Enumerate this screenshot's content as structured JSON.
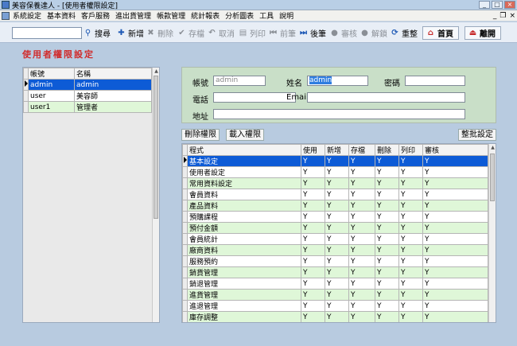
{
  "window": {
    "title": "美容保養達人 - [使用者權限設定]"
  },
  "menu": [
    "系統設定",
    "基本資料",
    "客戶服務",
    "進出貨管理",
    "帳款管理",
    "統計報表",
    "分析圖表",
    "工具",
    "說明"
  ],
  "toolbar": {
    "search_value": "",
    "search": "搜尋",
    "add": "新增",
    "delete": "刪除",
    "save": "存檔",
    "cancel": "取消",
    "print": "列印",
    "prev": "前筆",
    "next": "後筆",
    "audit": "審核",
    "unaudit": "解鎖",
    "refresh": "重整",
    "home": "首頁",
    "exit": "離開"
  },
  "page_title": "使用者權限設定",
  "users": {
    "headers": [
      "帳號",
      "名稱"
    ],
    "rows": [
      {
        "account": "admin",
        "name": "admin"
      },
      {
        "account": "user",
        "name": "美容師"
      },
      {
        "account": "user1",
        "name": "管理者"
      }
    ]
  },
  "form": {
    "account_label": "帳號",
    "account_value": "admin",
    "name_label": "姓名",
    "name_value": "admin",
    "password_label": "密碼",
    "password_value": "",
    "phone_label": "電話",
    "phone_value": "",
    "email_label": "Email",
    "email_value": "",
    "address_label": "地址",
    "address_value": ""
  },
  "buttons": {
    "delete_perm": "刪除權限",
    "load_perm": "載入權限",
    "batch": "整批設定"
  },
  "permissions": {
    "headers": [
      "程式",
      "使用",
      "新增",
      "存檔",
      "刪除",
      "列印",
      "審核"
    ],
    "rows": [
      {
        "program": "基本設定",
        "use": "Y",
        "add": "Y",
        "save": "Y",
        "del": "Y",
        "print": "Y",
        "audit": "Y"
      },
      {
        "program": "使用者設定",
        "use": "Y",
        "add": "Y",
        "save": "Y",
        "del": "Y",
        "print": "Y",
        "audit": "Y"
      },
      {
        "program": "常用資料設定",
        "use": "Y",
        "add": "Y",
        "save": "Y",
        "del": "Y",
        "print": "Y",
        "audit": "Y"
      },
      {
        "program": "會員資料",
        "use": "Y",
        "add": "Y",
        "save": "Y",
        "del": "Y",
        "print": "Y",
        "audit": "Y"
      },
      {
        "program": "產品資料",
        "use": "Y",
        "add": "Y",
        "save": "Y",
        "del": "Y",
        "print": "Y",
        "audit": "Y"
      },
      {
        "program": "預購課程",
        "use": "Y",
        "add": "Y",
        "save": "Y",
        "del": "Y",
        "print": "Y",
        "audit": "Y"
      },
      {
        "program": "預付金額",
        "use": "Y",
        "add": "Y",
        "save": "Y",
        "del": "Y",
        "print": "Y",
        "audit": "Y"
      },
      {
        "program": "會員統計",
        "use": "Y",
        "add": "Y",
        "save": "Y",
        "del": "Y",
        "print": "Y",
        "audit": "Y"
      },
      {
        "program": "廠商資料",
        "use": "Y",
        "add": "Y",
        "save": "Y",
        "del": "Y",
        "print": "Y",
        "audit": "Y"
      },
      {
        "program": "服務預約",
        "use": "Y",
        "add": "Y",
        "save": "Y",
        "del": "Y",
        "print": "Y",
        "audit": "Y"
      },
      {
        "program": "銷貨管理",
        "use": "Y",
        "add": "Y",
        "save": "Y",
        "del": "Y",
        "print": "Y",
        "audit": "Y"
      },
      {
        "program": "銷退管理",
        "use": "Y",
        "add": "Y",
        "save": "Y",
        "del": "Y",
        "print": "Y",
        "audit": "Y"
      },
      {
        "program": "進貨管理",
        "use": "Y",
        "add": "Y",
        "save": "Y",
        "del": "Y",
        "print": "Y",
        "audit": "Y"
      },
      {
        "program": "進退管理",
        "use": "Y",
        "add": "Y",
        "save": "Y",
        "del": "Y",
        "print": "Y",
        "audit": "Y"
      },
      {
        "program": "庫存調整",
        "use": "Y",
        "add": "Y",
        "save": "Y",
        "del": "Y",
        "print": "Y",
        "audit": "Y"
      }
    ]
  },
  "colors": {
    "selection": "#0d5bd6",
    "alt_row": "#dff7d8",
    "title": "#d12a2a",
    "form_bg": "#c9dfc8"
  }
}
